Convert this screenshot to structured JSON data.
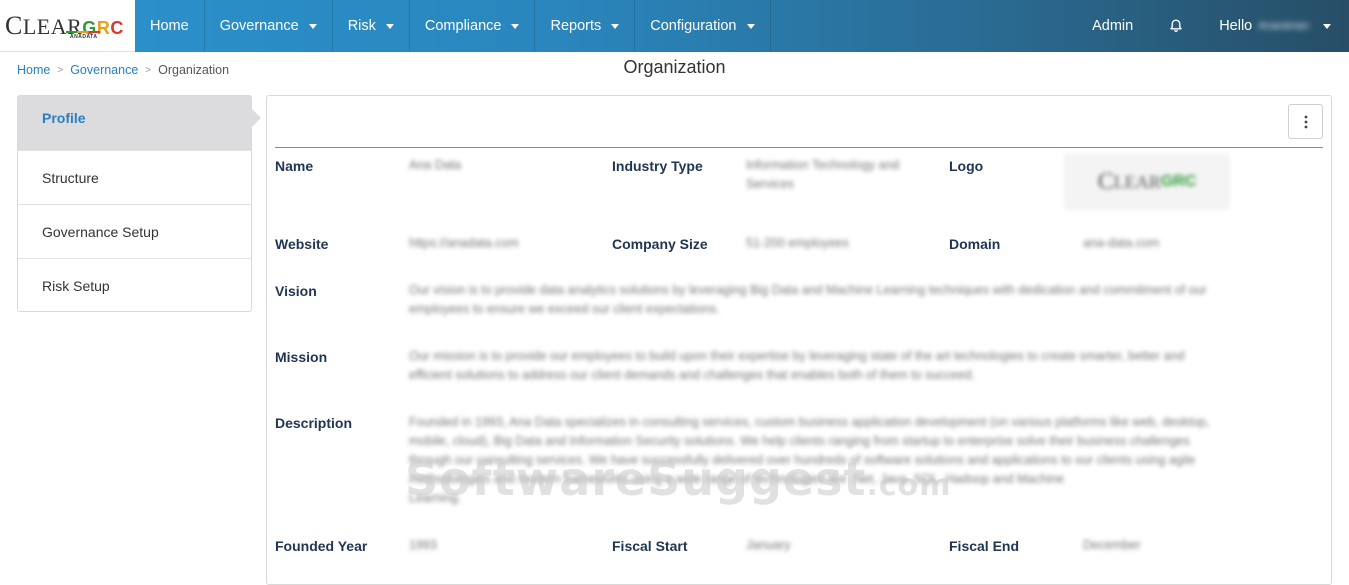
{
  "brand": {
    "logo_first": "C",
    "logo_rest": "LEAR",
    "logo_g": "G",
    "logo_r": "R",
    "logo_c": "C",
    "logo_sub": "ANADATA"
  },
  "nav": {
    "home": "Home",
    "governance": "Governance",
    "risk": "Risk",
    "compliance": "Compliance",
    "reports": "Reports",
    "configuration": "Configuration",
    "admin": "Admin",
    "hello": "Hello",
    "user_name": "Anaraman"
  },
  "breadcrumb": {
    "home": "Home",
    "governance": "Governance",
    "current": "Organization",
    "separator": ">"
  },
  "page_title": "Organization",
  "left_menu": [
    {
      "label": "Profile"
    },
    {
      "label": "Structure"
    },
    {
      "label": "Governance Setup"
    },
    {
      "label": "Risk Setup"
    }
  ],
  "profile": {
    "name_label": "Name",
    "name_value": "Ana Data",
    "industry_label": "Industry Type",
    "industry_value_line1": "Information Technology and",
    "industry_value_line2": "Services",
    "logo_label": "Logo",
    "website_label": "Website",
    "website_value": "https://anadata.com",
    "company_size_label": "Company Size",
    "company_size_value": "51-200 employees",
    "domain_label": "Domain",
    "domain_value": "ana-data.com",
    "vision_label": "Vision",
    "vision_line1": "Our vision is to provide data analytics solutions by leveraging Big Data and Machine Learning techniques with dedication and commitment of our",
    "vision_line2": "employees to ensure we exceed our client expectations.",
    "mission_label": "Mission",
    "mission_line1": "Our mission is to provide our employees to build upon their expertise by leveraging state of the art technologies to create smarter, better and",
    "mission_line2": "efficient solutions to address our client demands and challenges that enables both of them to succeed.",
    "description_label": "Description",
    "description_line1": "Founded in 1993, Ana Data specializes in consulting services, custom business application development (on various platforms like web, desktop,",
    "description_line2": "mobile, cloud), Big Data and Information Security solutions. We help clients ranging from startup to enterprise solve their business challenges",
    "description_line3": "through our consulting services. We have successfully delivered over hundreds of software solutions and applications to our clients using agile",
    "description_line4": "methodologies and modern frameworks using a wide range of technologies like .Net, Java, SQL, Hadoop and Machine",
    "description_line5": "Learning.",
    "founded_label": "Founded Year",
    "founded_value": "1993",
    "fiscal_start_label": "Fiscal Start",
    "fiscal_start_value": "January",
    "fiscal_end_label": "Fiscal End",
    "fiscal_end_value": "December"
  },
  "watermark": {
    "main": "SoftwareSuggest",
    "suffix": ".com"
  }
}
